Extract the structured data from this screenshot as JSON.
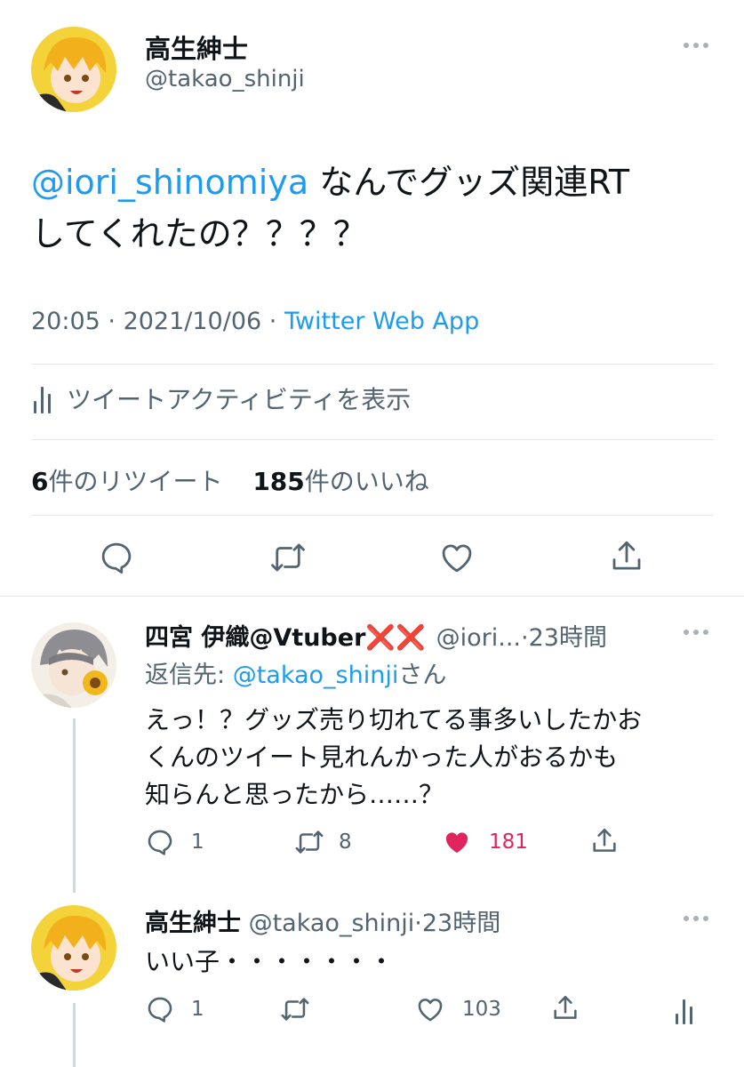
{
  "main_tweet": {
    "display_name": "高生紳士",
    "handle": "@takao_shinji",
    "mention": "@iori_shinomiya",
    "text_line1_rest": " なんでグッズ関連RT",
    "text_line2": "してくれたの？？？？",
    "time": "20:05",
    "sep1": " · ",
    "date": "2021/10/06",
    "sep2": " · ",
    "source": "Twitter Web App",
    "activity_label": "ツイートアクティビティを表示",
    "retweet_count": "6",
    "retweet_label": "件のリツイート",
    "like_count": "185",
    "like_label": "件のいいね"
  },
  "reply1": {
    "display_name": "四宮 伊織@Vtuber",
    "name_emoji": "❌❌",
    "handle": "@iori...",
    "time": "23時間",
    "replying_prefix": "返信先: ",
    "replying_handle": "@takao_shinji",
    "replying_suffix": "さん",
    "text_lines": [
      "えっ！？グッズ売り切れてる事多いしたかお",
      "くんのツイート見れんかった人がおるかも",
      "知らんと思ったから……？"
    ],
    "reply_count": "1",
    "retweet_count": "8",
    "like_count": "181",
    "liked": true
  },
  "reply2": {
    "display_name": "高生紳士",
    "handle": "@takao_shinji",
    "time": "23時間",
    "text": "いい子・・・・・・・",
    "reply_count": "1",
    "like_count": "103"
  },
  "colors": {
    "link": "#1d9bf0",
    "like_active": "#e0245e",
    "muted": "#536471"
  }
}
